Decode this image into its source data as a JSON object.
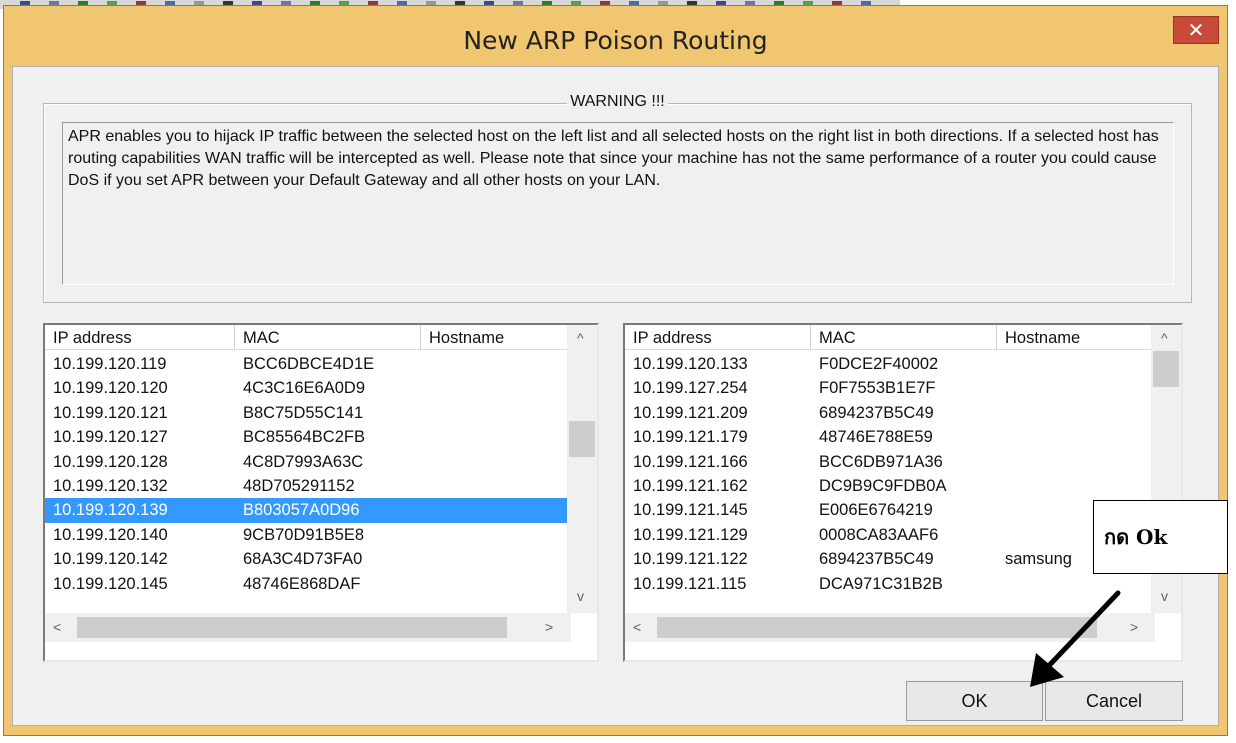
{
  "window": {
    "title": "New ARP Poison Routing",
    "close_symbol": "✕"
  },
  "warning": {
    "legend": "WARNING !!!",
    "text": "APR enables you to hijack IP traffic between the selected host on the left list and all selected hosts on the right list in both directions. If a selected host has routing capabilities WAN traffic will be intercepted as well. Please note that since your machine has not the same performance of a router you could cause DoS if you set APR between your Default Gateway and all other hosts on your LAN."
  },
  "left_list": {
    "columns": [
      "IP address",
      "MAC",
      "Hostname"
    ],
    "rows": [
      {
        "ip": "10.199.120.119",
        "mac": "BCC6DBCE4D1E",
        "host": ""
      },
      {
        "ip": "10.199.120.120",
        "mac": "4C3C16E6A0D9",
        "host": ""
      },
      {
        "ip": "10.199.120.121",
        "mac": "B8C75D55C141",
        "host": ""
      },
      {
        "ip": "10.199.120.127",
        "mac": "BC85564BC2FB",
        "host": ""
      },
      {
        "ip": "10.199.120.128",
        "mac": "4C8D7993A63C",
        "host": ""
      },
      {
        "ip": "10.199.120.132",
        "mac": "48D705291152",
        "host": ""
      },
      {
        "ip": "10.199.120.139",
        "mac": "B803057A0D96",
        "host": "",
        "selected": true
      },
      {
        "ip": "10.199.120.140",
        "mac": "9CB70D91B5E8",
        "host": ""
      },
      {
        "ip": "10.199.120.142",
        "mac": "68A3C4D73FA0",
        "host": ""
      },
      {
        "ip": "10.199.120.145",
        "mac": "48746E868DAF",
        "host": ""
      }
    ]
  },
  "right_list": {
    "columns": [
      "IP address",
      "MAC",
      "Hostname"
    ],
    "rows": [
      {
        "ip": "10.199.120.133",
        "mac": "F0DCE2F40002",
        "host": ""
      },
      {
        "ip": "10.199.127.254",
        "mac": "F0F7553B1E7F",
        "host": ""
      },
      {
        "ip": "10.199.121.209",
        "mac": "6894237B5C49",
        "host": ""
      },
      {
        "ip": "10.199.121.179",
        "mac": "48746E788E59",
        "host": ""
      },
      {
        "ip": "10.199.121.166",
        "mac": "BCC6DB971A36",
        "host": ""
      },
      {
        "ip": "10.199.121.162",
        "mac": "DC9B9C9FDB0A",
        "host": ""
      },
      {
        "ip": "10.199.121.145",
        "mac": "E006E6764219",
        "host": ""
      },
      {
        "ip": "10.199.121.129",
        "mac": "0008CA83AAF6",
        "host": ""
      },
      {
        "ip": "10.199.121.122",
        "mac": "6894237B5C49",
        "host": "samsung"
      },
      {
        "ip": "10.199.121.115",
        "mac": "DCA971C31B2B",
        "host": ""
      }
    ]
  },
  "buttons": {
    "ok": "OK",
    "cancel": "Cancel"
  },
  "annotation": {
    "text": "กด Ok"
  },
  "icons": {
    "scroll_up": "^",
    "scroll_down": "v",
    "scroll_left": "<",
    "scroll_right": ">"
  },
  "colors": {
    "title_bar": "#f1c671",
    "selection": "#3399ff",
    "close_button": "#c84a3a"
  }
}
